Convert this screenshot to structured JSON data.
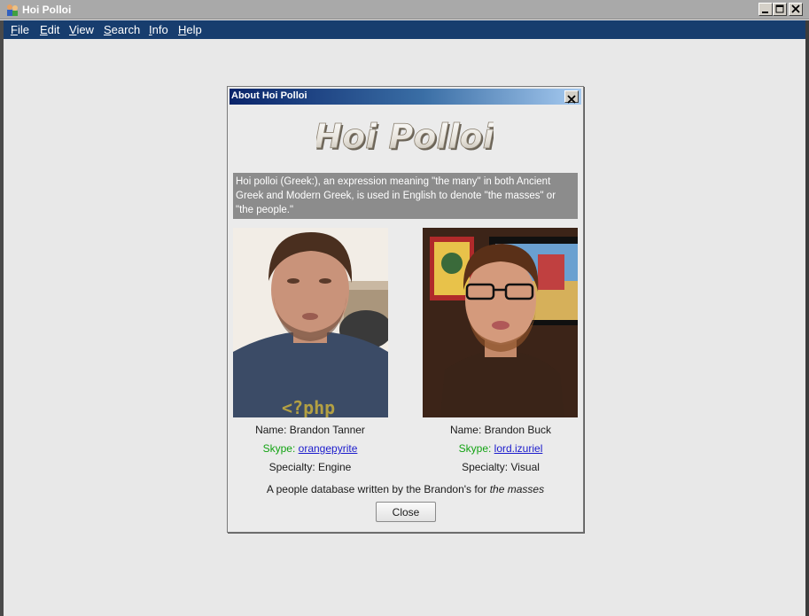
{
  "window": {
    "title": "Hoi Polloi",
    "app_icon": "people-icon",
    "controls": [
      "minimize-icon",
      "maximize-icon",
      "close-icon"
    ]
  },
  "menu": {
    "items": [
      {
        "label": "File",
        "mnemonic": "F"
      },
      {
        "label": "Edit",
        "mnemonic": "E"
      },
      {
        "label": "View",
        "mnemonic": "V"
      },
      {
        "label": "Search",
        "mnemonic": "S"
      },
      {
        "label": "Info",
        "mnemonic": "I"
      },
      {
        "label": "Help",
        "mnemonic": "H"
      }
    ]
  },
  "dialog": {
    "title": "About Hoi Polloi",
    "logo_text": "Hoi Polloi",
    "description": "Hoi polloi (Greek:), an expression meaning \"the many\" in both Ancient Greek and Modern Greek, is used in English to denote \"the masses\" or \"the people.\"",
    "people": [
      {
        "name": "Name: Brandon Tanner",
        "skype_label": "Skype:",
        "skype_handle": "orangepyrite",
        "specialty": "Specialty: Engine",
        "shirt_text": "<?php"
      },
      {
        "name": "Name: Brandon Buck",
        "skype_label": "Skype:",
        "skype_handle": "lord.izuriel",
        "specialty": "Specialty: Visual"
      }
    ],
    "footer_prefix": "A people database written by the Brandon's for ",
    "footer_emphasis": "the masses",
    "close_label": "Close"
  },
  "colors": {
    "menubar": "#173d6e",
    "titlebar": "#a9a9a9",
    "skype_label": "#13a313",
    "link": "#1c1ccc",
    "description_bg": "#8c8c8c"
  }
}
